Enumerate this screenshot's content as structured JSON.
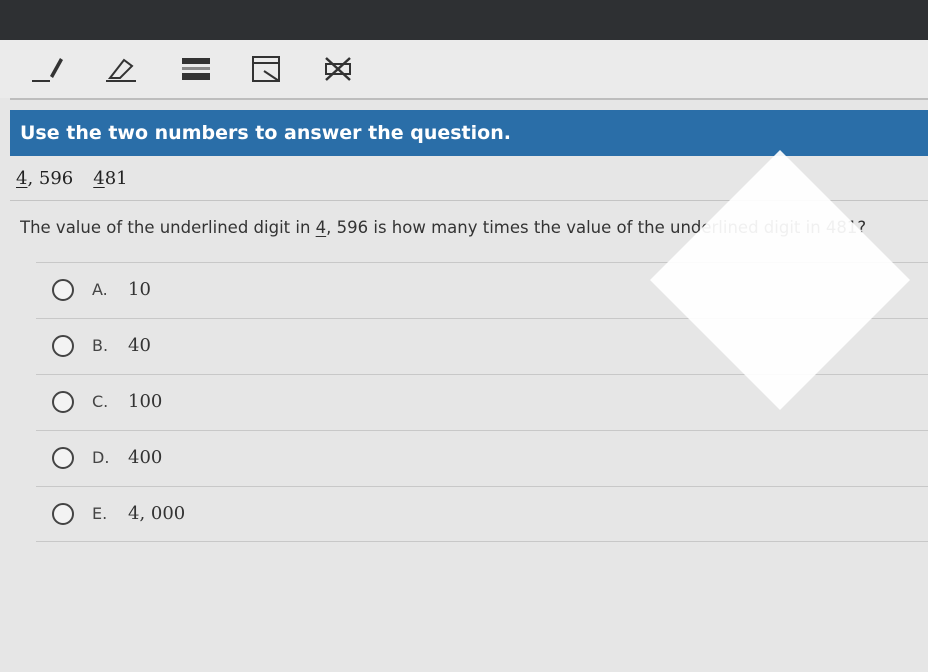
{
  "toolbar": {
    "tools": [
      {
        "icon": "pencil-icon"
      },
      {
        "icon": "eraser-icon"
      },
      {
        "icon": "line-reader-icon"
      },
      {
        "icon": "masking-icon"
      },
      {
        "icon": "answer-eliminator-icon"
      }
    ]
  },
  "banner": {
    "text": "Use the two numbers to answer the question."
  },
  "numbers": {
    "first": {
      "underlined": "4",
      "rest": ", 596"
    },
    "second": {
      "underlined": "4",
      "rest": "81"
    }
  },
  "question": {
    "before": "The value of the underlined digit in ",
    "underlined_digit": "4",
    "number_rest": ", 596",
    "after": " is how many times the value of the underlined digit in 481?"
  },
  "choices": [
    {
      "letter": "A.",
      "value": "10"
    },
    {
      "letter": "B.",
      "value": "40"
    },
    {
      "letter": "C.",
      "value": "100"
    },
    {
      "letter": "D.",
      "value": "400"
    },
    {
      "letter": "E.",
      "value": "4, 000"
    }
  ],
  "colors": {
    "banner": "#2a6ea8",
    "top_bar": "#2e3033"
  }
}
